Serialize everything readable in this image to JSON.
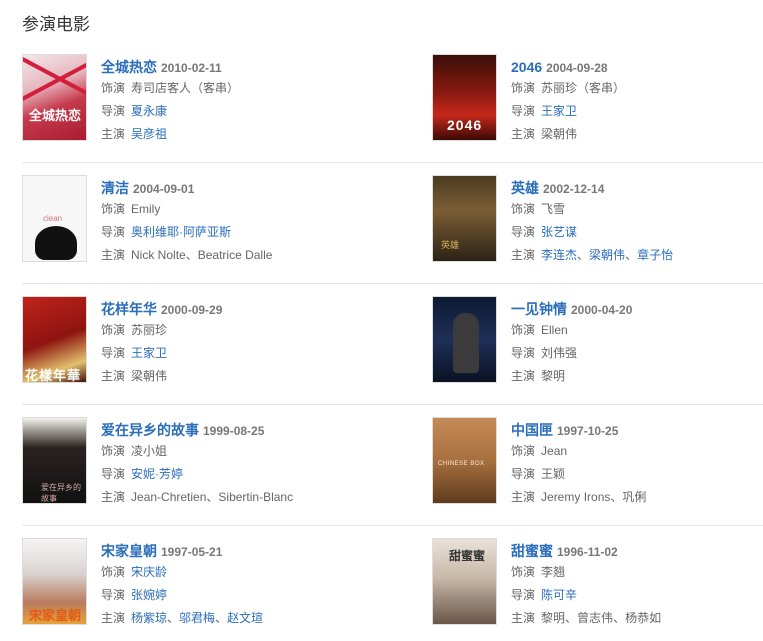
{
  "section": {
    "title": "参演电影"
  },
  "labels": {
    "role": "饰演",
    "director": "导演",
    "cast": "主演"
  },
  "films": [
    {
      "title": "全城热恋",
      "date": "2010-02-11",
      "role": "寿司店客人（客串）",
      "role_linked": false,
      "directors": [
        "夏永康"
      ],
      "directors_linked": true,
      "cast": [
        "吴彦祖"
      ],
      "cast_linked": true,
      "poster_text": "全城热恋"
    },
    {
      "title": "2046",
      "date": "2004-09-28",
      "role": "苏丽珍（客串）",
      "role_linked": false,
      "directors": [
        "王家卫"
      ],
      "directors_linked": true,
      "cast": [
        "梁朝伟"
      ],
      "cast_linked": false,
      "poster_text": "2046"
    },
    {
      "title": "清洁",
      "date": "2004-09-01",
      "role": "Emily",
      "role_linked": false,
      "directors": [
        "奥利维耶·阿萨亚斯"
      ],
      "directors_linked": true,
      "cast": [
        "Nick Nolte",
        "Beatrice Dalle"
      ],
      "cast_linked": false,
      "poster_text": "clean"
    },
    {
      "title": "英雄",
      "date": "2002-12-14",
      "role": "飞雪",
      "role_linked": false,
      "directors": [
        "张艺谋"
      ],
      "directors_linked": true,
      "cast": [
        "李连杰",
        "梁朝伟",
        "章子怡"
      ],
      "cast_linked": true,
      "poster_text": "英雄"
    },
    {
      "title": "花样年华",
      "date": "2000-09-29",
      "role": "苏丽珍",
      "role_linked": false,
      "directors": [
        "王家卫"
      ],
      "directors_linked": true,
      "cast": [
        "梁朝伟"
      ],
      "cast_linked": false,
      "poster_text": "花樣年華"
    },
    {
      "title": "一见钟情",
      "date": "2000-04-20",
      "role": "Ellen",
      "role_linked": false,
      "directors": [
        "刘伟强"
      ],
      "directors_linked": false,
      "cast": [
        "黎明"
      ],
      "cast_linked": false,
      "poster_text": ""
    },
    {
      "title": "爱在异乡的故事",
      "date": "1999-08-25",
      "role": "凌小姐",
      "role_linked": false,
      "directors": [
        "安妮·芳婷"
      ],
      "directors_linked": true,
      "cast": [
        "Jean-Chretien",
        "Sibertin-Blanc"
      ],
      "cast_linked": false,
      "poster_text": "爱在异乡的故事"
    },
    {
      "title": "中国匣",
      "date": "1997-10-25",
      "role": "Jean",
      "role_linked": false,
      "directors": [
        "王颖"
      ],
      "directors_linked": false,
      "cast": [
        "Jeremy Irons",
        "巩俐"
      ],
      "cast_linked": false,
      "poster_text": "CHINESE BOX"
    },
    {
      "title": "宋家皇朝",
      "date": "1997-05-21",
      "role": "宋庆龄",
      "role_linked": true,
      "directors": [
        "张婉婷"
      ],
      "directors_linked": true,
      "cast": [
        "杨紫琼",
        "邬君梅",
        "赵文瑄"
      ],
      "cast_linked": true,
      "poster_text": "宋家皇朝"
    },
    {
      "title": "甜蜜蜜",
      "date": "1996-11-02",
      "role": "李翘",
      "role_linked": false,
      "directors": [
        "陈可辛"
      ],
      "directors_linked": true,
      "cast": [
        "黎明",
        "曾志伟",
        "杨恭如"
      ],
      "cast_linked": false,
      "poster_text": "甜蜜蜜"
    }
  ]
}
